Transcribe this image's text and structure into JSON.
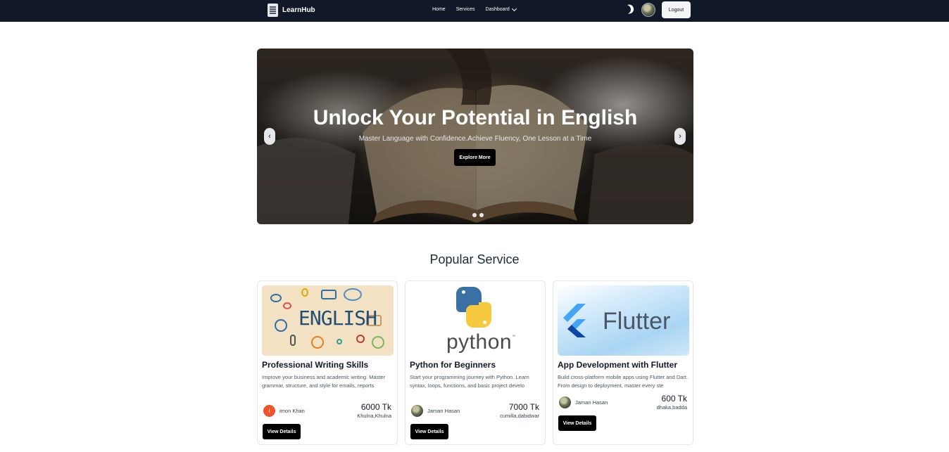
{
  "nav": {
    "brand": "LearnHub",
    "links": [
      "Home",
      "Services"
    ],
    "dashboard": "Dashboard",
    "logout": "Logout"
  },
  "hero": {
    "title": "Unlock Your Potential in English",
    "subtitle": "Master Language with Confidence.Achieve Fluency, One Lesson at a Time",
    "button": "Explore More",
    "prev": "‹",
    "next": "›",
    "slide_count": 2
  },
  "section": {
    "title": "Popular Service"
  },
  "cards": [
    {
      "image_text": "ENGLISH",
      "title": "Professional Writing Skills",
      "description": "Improve your business and academic writing. Master grammar, structure, and style for emails, reports",
      "provider": "imon Khan",
      "provider_initial": "i",
      "price": "6000 Tk",
      "location": "Khulna,Khulna",
      "button": "View Details"
    },
    {
      "image_text": "python",
      "image_tm": "™",
      "title": "Python for Beginners",
      "description": "Start your programming journey with Python. Learn syntax, loops, functions, and basic project develo",
      "provider": "Jaman Hasan",
      "price": "7000 Tk",
      "location": "cumilla,dabidwar",
      "button": "View Details"
    },
    {
      "image_text": "Flutter",
      "title": "App Development with Flutter",
      "description": "Build cross-platform mobile apps using Flutter and Dart. From design to deployment, master every ste",
      "provider": "Jaman Hasan",
      "price": "600 Tk",
      "location": "dhaka,badda",
      "button": "View Details"
    }
  ],
  "colors": {
    "navbar": "#111827",
    "button": "#000000",
    "python_blue": "#3a70a3",
    "python_yellow": "#f7c93e",
    "flutter_blue": "#42a5f5"
  }
}
